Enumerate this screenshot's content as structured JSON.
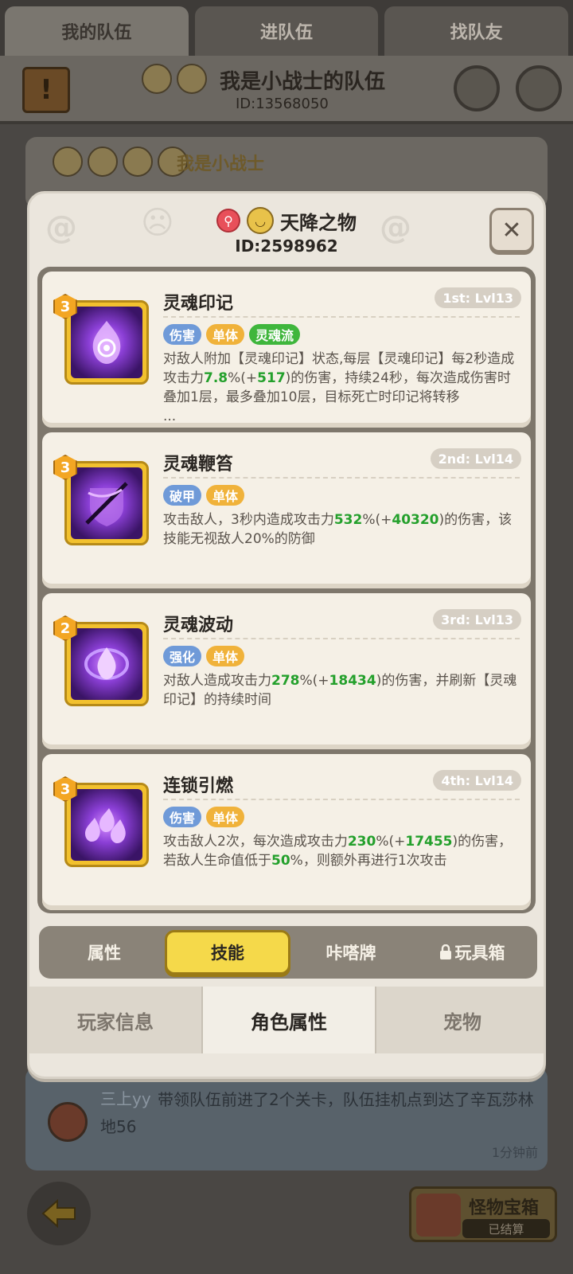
{
  "top_tabs": [
    "我的队伍",
    "进队伍",
    "找队友"
  ],
  "team": {
    "name": "我是小战士的队伍",
    "id": "ID:13568050"
  },
  "member": {
    "name": "我是小战士"
  },
  "modal": {
    "title": "天降之物",
    "id": "ID:2598962",
    "close_label": "✕"
  },
  "skills": [
    {
      "name": "灵魂印记",
      "level": "1st: Lvl13",
      "stars": "3",
      "tags": [
        "伤害",
        "单体",
        "灵魂流"
      ],
      "desc_parts": [
        "对敌人附加【灵魂印记】状态,每层【灵魂印记】每2秒造成攻击力",
        "7.8",
        "%(+",
        "517",
        ")的伤害，持续24秒，每次造成伤害时叠加1层，最多叠加10层，目标死亡时印记将转移",
        "..."
      ]
    },
    {
      "name": "灵魂鞭笞",
      "level": "2nd: Lvl14",
      "stars": "3",
      "tags": [
        "破甲",
        "单体"
      ],
      "desc_parts": [
        "攻击敌人，3秒内造成攻击力",
        "532",
        "%(+",
        "40320",
        ")的伤害，该技能无视敌人20%的防御"
      ]
    },
    {
      "name": "灵魂波动",
      "level": "3rd: Lvl13",
      "stars": "2",
      "tags": [
        "强化",
        "单体"
      ],
      "desc_parts": [
        "对敌人造成攻击力",
        "278",
        "%(+",
        "18434",
        ")的伤害，并刷新【灵魂印记】的持续时间"
      ]
    },
    {
      "name": "连锁引燃",
      "level": "4th: Lvl14",
      "stars": "3",
      "tags": [
        "伤害",
        "单体"
      ],
      "desc_parts": [
        "攻击敌人2次，每次造成攻击力",
        "230",
        "%(+",
        "17455",
        ")的伤害，若敌人生命值低于",
        "50",
        "%，则额外再进行1次攻击"
      ]
    }
  ],
  "tag_colors": {
    "伤害": "#6f9ad8",
    "单体": "#f0b23a",
    "灵魂流": "#3fb63c",
    "破甲": "#6f9ad8",
    "强化": "#6f9ad8"
  },
  "tab_bar": [
    "属性",
    "技能",
    "咔嗒牌",
    "玩具箱"
  ],
  "bottom_tabs": [
    "玩家信息",
    "角色属性",
    "宠物"
  ],
  "feed": {
    "user": "三上yy",
    "text": "带领队伍前进了2个关卡，队伍挂机点到达了辛瓦莎林地56",
    "time": "1分钟前"
  },
  "chest": {
    "title": "怪物宝箱",
    "status": "已结算"
  },
  "colors": {
    "highlight": "#24a02c",
    "active_tab": "#f5d94a"
  }
}
